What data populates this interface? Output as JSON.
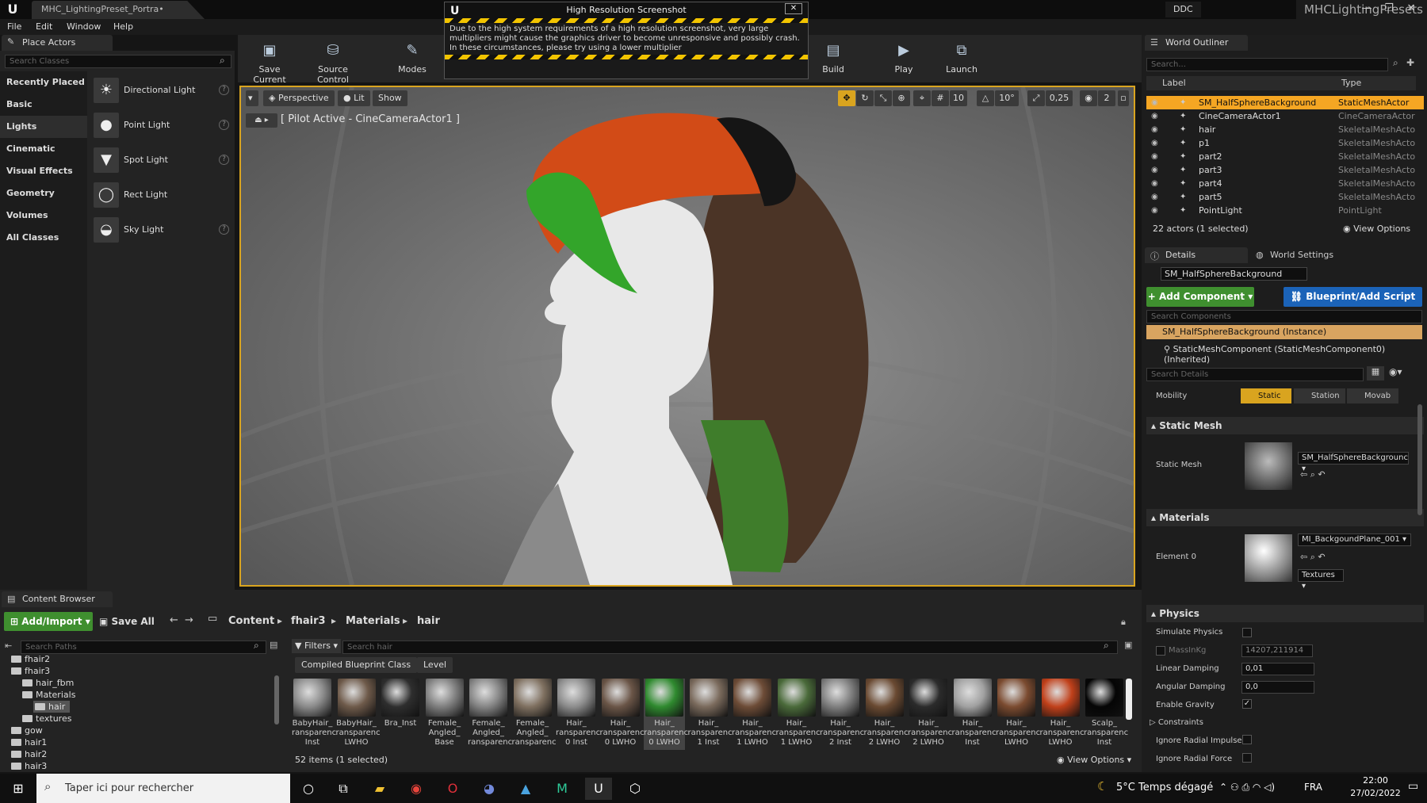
{
  "window": {
    "doc_tab": "MHC_LightingPreset_Portra•",
    "ddc": "DDC",
    "project": "MHCLightingPresets"
  },
  "menu": [
    "File",
    "Edit",
    "Window",
    "Help"
  ],
  "place_actors": {
    "tab": "Place Actors",
    "search_placeholder": "Search Classes",
    "categories": [
      "Recently Placed",
      "Basic",
      "Lights",
      "Cinematic",
      "Visual Effects",
      "Geometry",
      "Volumes",
      "All Classes"
    ],
    "selected_category": "Lights",
    "actors": [
      {
        "label": "Directional Light",
        "icon": "sun-icon"
      },
      {
        "label": "Point Light",
        "icon": "bulb-icon"
      },
      {
        "label": "Spot Light",
        "icon": "spotlight-icon"
      },
      {
        "label": "Rect Light",
        "icon": "rect-light-icon"
      },
      {
        "label": "Sky Light",
        "icon": "sky-light-icon"
      }
    ]
  },
  "toolbar": [
    {
      "label": "Save Current",
      "icon": "save-icon"
    },
    {
      "label": "Source Control",
      "icon": "source-control-icon"
    },
    {
      "label": "Modes",
      "icon": "modes-icon"
    },
    {
      "label": "Build",
      "icon": "build-icon"
    },
    {
      "label": "Play",
      "icon": "play-icon"
    },
    {
      "label": "Launch",
      "icon": "launch-icon"
    }
  ],
  "dialog": {
    "title": "High Resolution Screenshot",
    "message": "Due to the high system requirements of a high resolution screenshot, very large multipliers might cause the graphics driver to become unresponsive and possibly crash. In these circumstances, please try using a lower multiplier"
  },
  "viewport": {
    "perspective": "Perspective",
    "lit": "Lit",
    "show": "Show",
    "pilot": "[ Pilot Active - CineCameraActor1 ]",
    "grid": "10",
    "rotation": "10°",
    "scale": "0,25",
    "camera_speed": "2"
  },
  "outliner": {
    "tab": "World Outliner",
    "search_placeholder": "Search...",
    "col_label": "Label",
    "col_type": "Type",
    "rows": [
      {
        "name": "SM_HalfSphereBackground",
        "type": "StaticMeshActor",
        "selected": true
      },
      {
        "name": "CineCameraActor1",
        "type": "CineCameraActor"
      },
      {
        "name": "hair",
        "type": "SkeletalMeshActo"
      },
      {
        "name": "p1",
        "type": "SkeletalMeshActo"
      },
      {
        "name": "part2",
        "type": "SkeletalMeshActo"
      },
      {
        "name": "part3",
        "type": "SkeletalMeshActo"
      },
      {
        "name": "part4",
        "type": "SkeletalMeshActo"
      },
      {
        "name": "part5",
        "type": "SkeletalMeshActo"
      },
      {
        "name": "PointLight",
        "type": "PointLight"
      }
    ],
    "status": "22 actors (1 selected)",
    "view_options": "View Options"
  },
  "details": {
    "tab": "Details",
    "world_settings": "World Settings",
    "name": "SM_HalfSphereBackground",
    "add_component": "+ Add Component",
    "blueprint": "Blueprint/Add Script",
    "search_components": "Search Components",
    "instance": "SM_HalfSphereBackground (Instance)",
    "component": "StaticMeshComponent (StaticMeshComponent0) (Inherited)",
    "search_details": "Search Details",
    "mobility_label": "Mobility",
    "mobility": [
      "Static",
      "Station",
      "Movab"
    ],
    "static_mesh_section": "Static Mesh",
    "static_mesh_label": "Static Mesh",
    "static_mesh_value": "SM_HalfSphereBackgrounc",
    "materials_section": "Materials",
    "element0_label": "Element 0",
    "element0_value": "MI_BackgoundPlane_001",
    "textures": "Textures",
    "physics_section": "Physics",
    "simulate_physics": "Simulate Physics",
    "mass": "MassInKg",
    "mass_value": "14207,211914",
    "linear_damping": "Linear Damping",
    "linear_damping_value": "0,01",
    "angular_damping": "Angular Damping",
    "angular_damping_value": "0,0",
    "enable_gravity": "Enable Gravity",
    "constraints": "Constraints",
    "ignore_impulse": "Ignore Radial Impulse",
    "ignore_force": "Ignore Radial Force"
  },
  "content_browser": {
    "tab": "Content Browser",
    "add_import": "Add/Import",
    "save_all": "Save All",
    "path": [
      "Content",
      "fhair3",
      "Materials",
      "hair"
    ],
    "search_paths": "Search Paths",
    "filters": "Filters",
    "search_placeholder": "Search hair",
    "filter_chips": [
      "Compiled Blueprint Class",
      "Level"
    ],
    "tree": [
      {
        "label": "fhair2",
        "indent": 0
      },
      {
        "label": "fhair3",
        "indent": 0
      },
      {
        "label": "hair_fbm",
        "indent": 1
      },
      {
        "label": "Materials",
        "indent": 1
      },
      {
        "label": "hair",
        "indent": 2,
        "selected": true
      },
      {
        "label": "textures",
        "indent": 1
      },
      {
        "label": "gow",
        "indent": 0
      },
      {
        "label": "hair1",
        "indent": 0
      },
      {
        "label": "hair2",
        "indent": 0
      },
      {
        "label": "hair3",
        "indent": 0
      }
    ],
    "assets": [
      {
        "l1": "BabyHair_",
        "l2": "ransparenc",
        "l3": "Inst",
        "color": "#8a8a8a"
      },
      {
        "l1": "BabyHair_",
        "l2": "ransparenc",
        "l3": "LWHO",
        "color": "#6e5a4a"
      },
      {
        "l1": "Bra_Inst",
        "l2": "",
        "l3": "",
        "color": "#2e2e2e"
      },
      {
        "l1": "Female_",
        "l2": "Angled_",
        "l3": "Base",
        "color": "#7e7e7e"
      },
      {
        "l1": "Female_",
        "l2": "Angled_",
        "l3": "ransparenc",
        "color": "#858585"
      },
      {
        "l1": "Female_",
        "l2": "Angled_",
        "l3": "ransparenc",
        "color": "#7f7060"
      },
      {
        "l1": "Hair_",
        "l2": "ransparenc",
        "l3": "0 Inst",
        "color": "#8c8c8c"
      },
      {
        "l1": "Hair_",
        "l2": "ransparenc",
        "l3": "0 LWHO",
        "color": "#6a5547"
      },
      {
        "l1": "Hair_",
        "l2": "ransparenc",
        "l3": "0 LWHO",
        "color": "#2f8a2f",
        "selected": true
      },
      {
        "l1": "Hair_",
        "l2": "ransparenc",
        "l3": "1 Inst",
        "color": "#7a6a5c"
      },
      {
        "l1": "Hair_",
        "l2": "ransparenc",
        "l3": "1 LWHO",
        "color": "#6d4c37"
      },
      {
        "l1": "Hair_",
        "l2": "ransparenc",
        "l3": "1 LWHO",
        "color": "#4a6a3a"
      },
      {
        "l1": "Hair_",
        "l2": "ransparenc",
        "l3": "2 Inst",
        "color": "#7f7f7f"
      },
      {
        "l1": "Hair_",
        "l2": "ransparenc",
        "l3": "2 LWHO",
        "color": "#6a4a32"
      },
      {
        "l1": "Hair_",
        "l2": "ransparenc",
        "l3": "2 LWHO",
        "color": "#2b2b2b"
      },
      {
        "l1": "Hair_",
        "l2": "ransparenc",
        "l3": "Inst",
        "color": "#a0a0a0"
      },
      {
        "l1": "Hair_",
        "l2": "ransparenc",
        "l3": "LWHO",
        "color": "#7b4b30"
      },
      {
        "l1": "Hair_",
        "l2": "ransparenc",
        "l3": "LWHO",
        "color": "#c0401a"
      },
      {
        "l1": "Scalp_",
        "l2": "ransparenc",
        "l3": "Inst",
        "color": "#050505"
      }
    ],
    "status": "52 items (1 selected)",
    "view_options": "View Options"
  },
  "taskbar": {
    "search": "Taper ici pour rechercher",
    "weather": "5°C  Temps dégagé",
    "lang": "FRA",
    "time": "22:00",
    "date": "27/02/2022"
  },
  "colors": {
    "accent_orange": "#f5a623",
    "viewport_border": "#d9a41f",
    "add_green": "#3f8f2f",
    "blueprint_blue": "#1b63b8",
    "selection": "#f5a623"
  }
}
